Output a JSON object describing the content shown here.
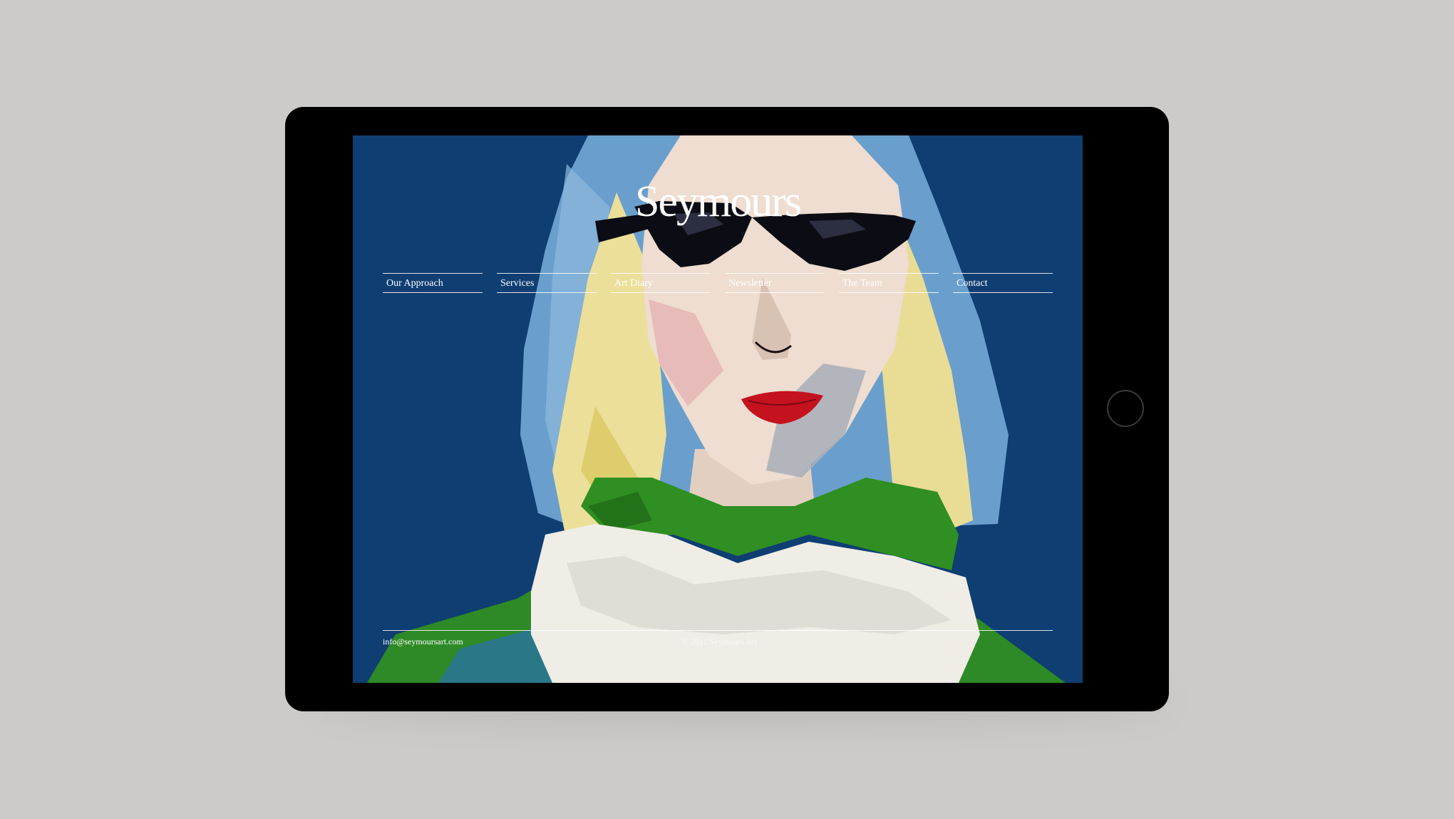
{
  "site": {
    "logo": "Seymours"
  },
  "nav": {
    "items": [
      {
        "label": "Our Approach"
      },
      {
        "label": "Services"
      },
      {
        "label": "Art Diary"
      },
      {
        "label": "Newsletter"
      },
      {
        "label": "The Team"
      },
      {
        "label": "Contact"
      }
    ]
  },
  "footer": {
    "email": "info@seymoursart.com",
    "copyright": "© 2011 Seymours Art"
  },
  "colors": {
    "page_background": "#cccbc9",
    "device_frame": "#000000",
    "screen_background": "#0d3b6e",
    "text": "#ffffff"
  },
  "images": {
    "hero": "painted sculpture portrait with black cat-eye sunglasses, red lips, blonde hair, blue hood and green collar on blue background"
  }
}
